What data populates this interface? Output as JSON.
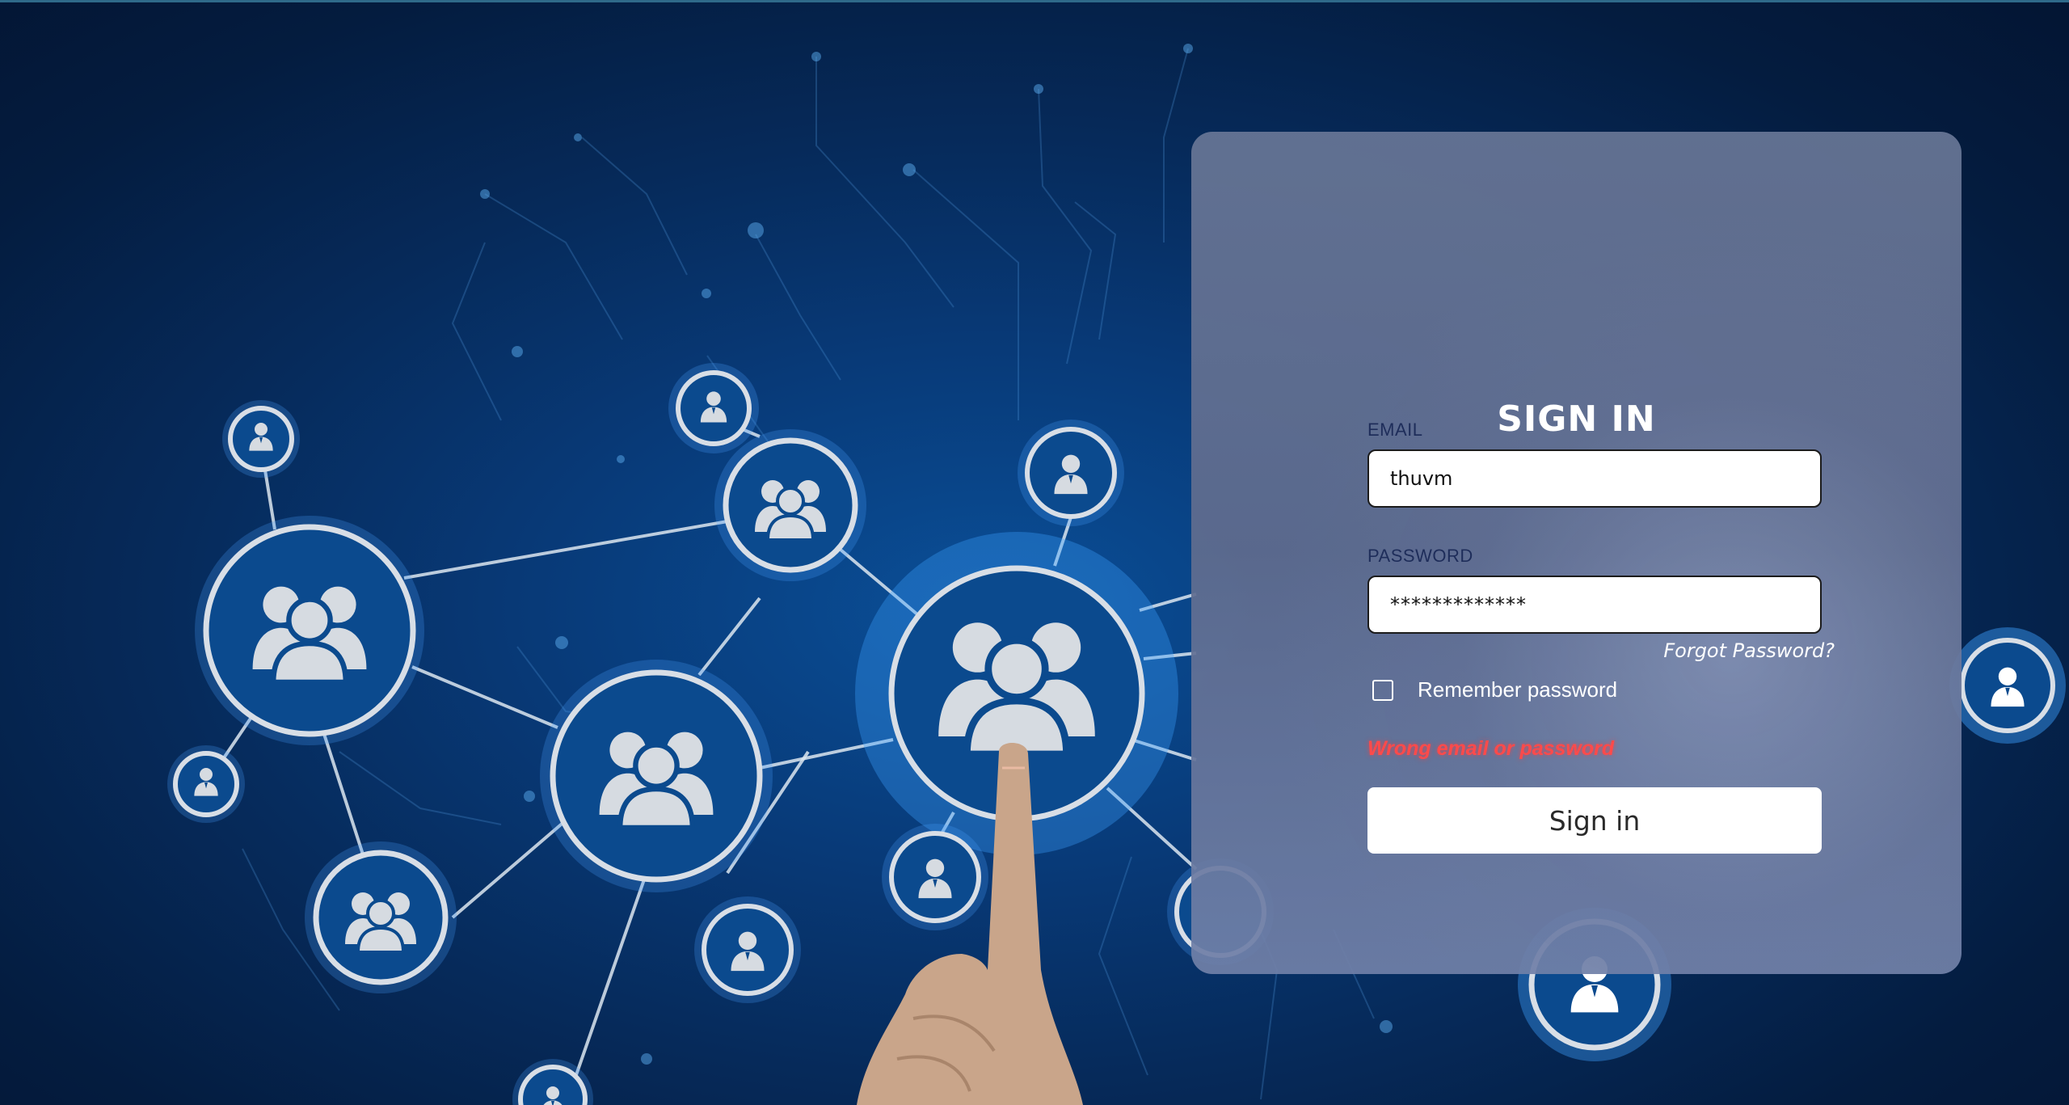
{
  "login": {
    "title": "SIGN IN",
    "email_label": "EMAIL",
    "email_value": "thuvm",
    "password_label": "PASSWORD",
    "password_value": "*************",
    "forgot_password": "Forgot Password?",
    "remember_label": "Remember password",
    "remember_checked": false,
    "error_message": "Wrong email or password",
    "submit_label": "Sign in"
  },
  "background": {
    "description_icons": [
      "people-group-icon",
      "person-icon"
    ]
  }
}
